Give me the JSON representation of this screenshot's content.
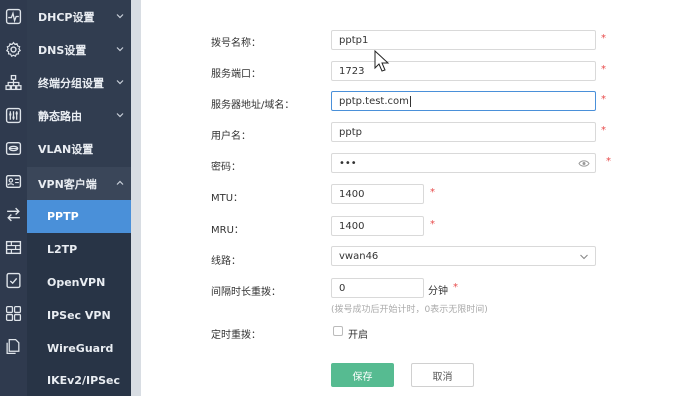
{
  "sidebar": {
    "items": [
      {
        "label": "DHCP设置",
        "icon": "monitor-pulse-icon"
      },
      {
        "label": "DNS设置",
        "icon": "gear-icon"
      },
      {
        "label": "终端分组设置",
        "icon": "network-group-icon"
      },
      {
        "label": "静态路由",
        "icon": "sliders-icon"
      },
      {
        "label": "VLAN设置",
        "icon": "vlan-icon"
      },
      {
        "label": "VPN客户端",
        "icon": "id-card-icon"
      }
    ],
    "sub_items": [
      {
        "label": "PPTP",
        "icon": "swap-arrows-icon"
      },
      {
        "label": "L2TP",
        "icon": "firewall-icon"
      },
      {
        "label": "OpenVPN",
        "icon": "check-document-icon"
      },
      {
        "label": "IPSec VPN",
        "icon": "grid-squares-icon"
      },
      {
        "label": "WireGuard",
        "icon": "copy-document-icon"
      },
      {
        "label": "IKEv2/IPSec",
        "icon": ""
      }
    ],
    "active_sub": "PPTP",
    "colors": {
      "rail": "#2f3a4e",
      "sidebar": "#313d50",
      "active": "#4a90d9"
    }
  },
  "form": {
    "dial_name": {
      "label": "拨号名称：",
      "value": "pptp1"
    },
    "server_port": {
      "label": "服务端口：",
      "value": "1723"
    },
    "server_addr": {
      "label": "服务器地址/域名：",
      "value": "pptp.test.com"
    },
    "username": {
      "label": "用户名：",
      "value": "pptp"
    },
    "password": {
      "label": "密码：",
      "value": "•••"
    },
    "mtu": {
      "label": "MTU：",
      "value": "1400"
    },
    "mru": {
      "label": "MRU：",
      "value": "1400"
    },
    "line": {
      "label": "线路：",
      "value": "vwan46"
    },
    "redial_interval": {
      "label": "间隔时长重拨：",
      "value": "0",
      "unit": "分钟",
      "hint": "(拨号成功后开始计时，0表示无限时间)"
    },
    "scheduled_redial": {
      "label": "定时重拨：",
      "option": "开启"
    },
    "required_mark": "*"
  },
  "buttons": {
    "save": "保存",
    "cancel": "取消"
  },
  "colors": {
    "save_button": "#56bb91",
    "required": "#e84a4a",
    "focus": "#4a90d9"
  }
}
